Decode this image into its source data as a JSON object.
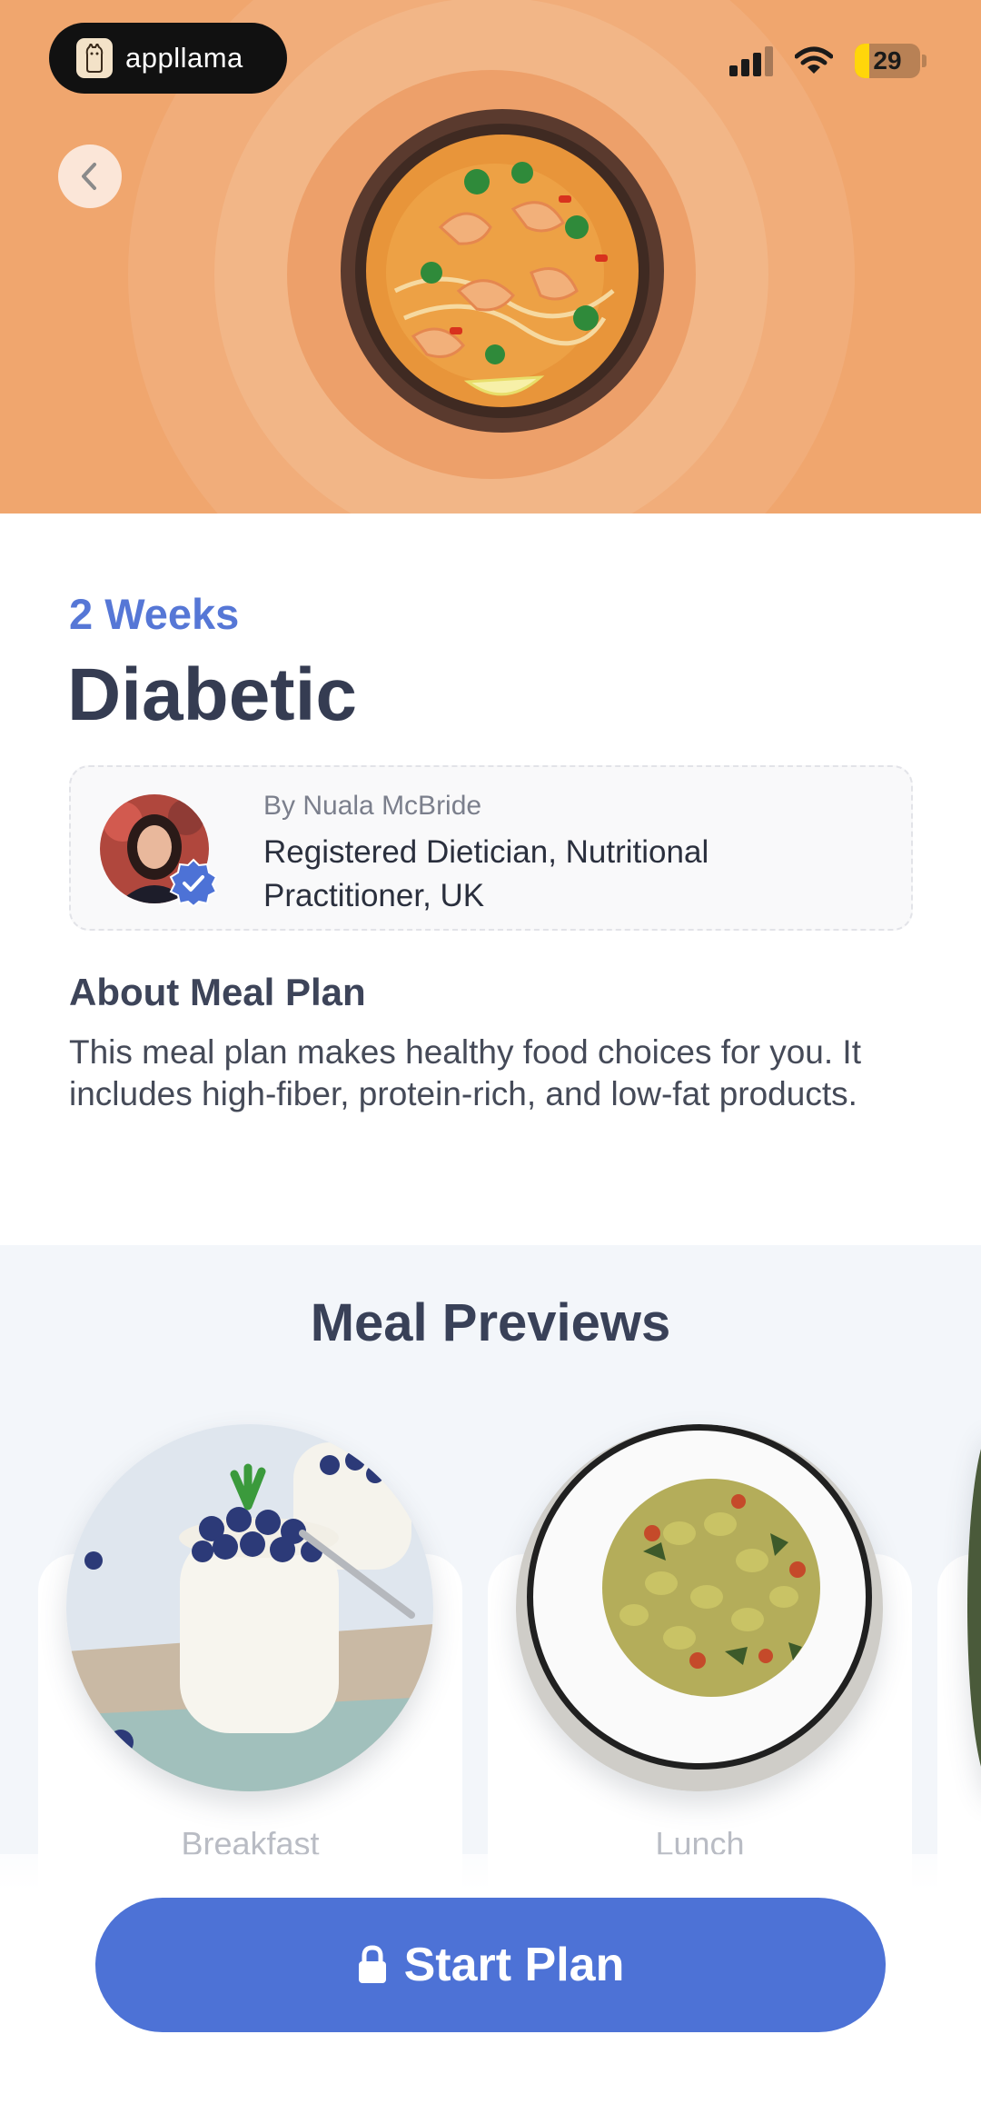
{
  "status_bar": {
    "brand_name": "appllama",
    "battery_level": "29",
    "battery_color": "#ffd60a"
  },
  "hero": {
    "background_color": "#f0a66e",
    "image_icon": "shrimp-curry-bowl",
    "back_icon": "chevron-left-icon"
  },
  "plan": {
    "duration": "2 Weeks",
    "title": "Diabetic",
    "accent_color": "#5677d6"
  },
  "author": {
    "by_line": "By Nuala McBride",
    "credentials": "Registered Dietician, Nutritional Practitioner, UK",
    "verified_icon": "verified-badge-icon"
  },
  "about": {
    "heading": "About Meal Plan",
    "text": "This meal plan makes healthy food choices for you. It includes high-fiber, protein-rich, and low-fat products."
  },
  "previews": {
    "title": "Meal Previews",
    "meals": [
      {
        "label": "Breakfast",
        "image_icon": "blueberry-yogurt-icon"
      },
      {
        "label": "Lunch",
        "image_icon": "gnocchi-bowl-icon"
      }
    ]
  },
  "cta": {
    "label": "Start Plan",
    "icon": "lock-icon",
    "color": "#4d72d6"
  }
}
